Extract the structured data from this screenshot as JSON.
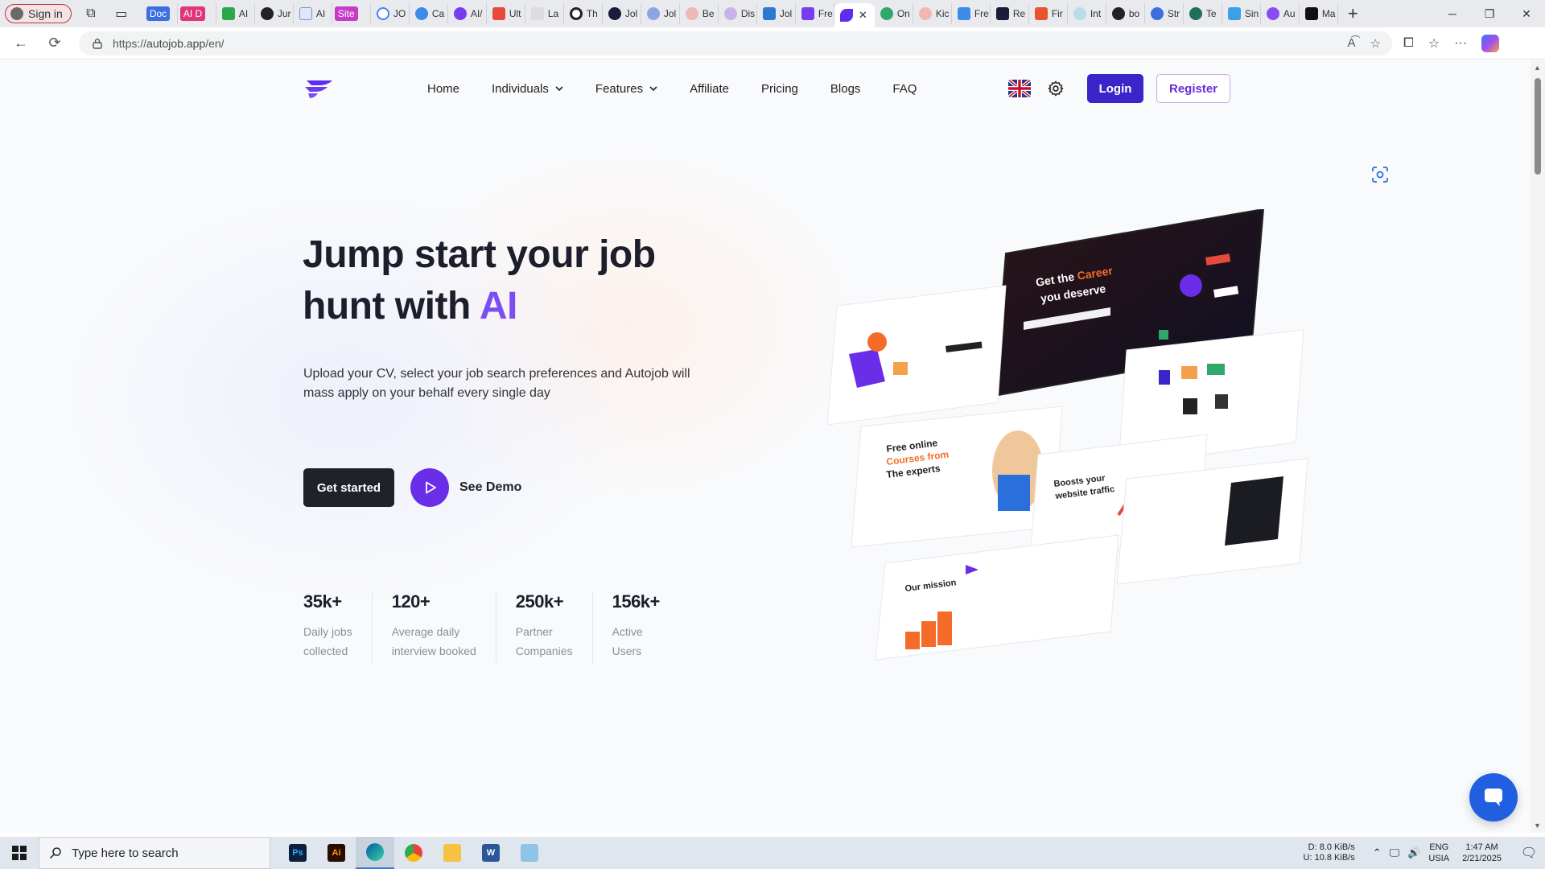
{
  "browser": {
    "profile_label": "Sign in",
    "tabs": [
      "Doc",
      "AI D",
      "AI",
      "Jur",
      "AI",
      "Site",
      "JO",
      "Ca",
      "AI/",
      "Ult",
      "La",
      "Th",
      "Jol",
      "Jol",
      "Be",
      "Dis",
      "Jol",
      "Fre",
      "",
      "On",
      "Kic",
      "Fre",
      "Re",
      "Fir",
      "Int",
      "bo",
      "Str",
      "Te",
      "Sin",
      "Au",
      "Ma"
    ],
    "url_prefix": "https://",
    "url_host": "autojob.app",
    "url_path": "/en/",
    "window_controls": {
      "minimize": "─",
      "restore": "❐",
      "close": "✕"
    }
  },
  "site": {
    "nav": {
      "items": [
        {
          "label": "Home"
        },
        {
          "label": "Individuals"
        },
        {
          "label": "Features"
        },
        {
          "label": "Affiliate"
        },
        {
          "label": "Pricing"
        },
        {
          "label": "Blogs"
        },
        {
          "label": "FAQ"
        }
      ],
      "login": "Login",
      "register": "Register"
    },
    "hero": {
      "title_line1": "Jump start your job",
      "title_line2_prefix": "hunt with ",
      "title_accent": "AI",
      "subtitle": "Upload your CV, select your job search preferences and Autojob will mass apply on your behalf every single day",
      "cta_primary": "Get started",
      "cta_secondary": "See Demo"
    },
    "stats": [
      {
        "value": "35k+",
        "label_line1": "Daily jobs",
        "label_line2": "collected"
      },
      {
        "value": "120+",
        "label_line1": "Average daily",
        "label_line2": "interview booked"
      },
      {
        "value": "250k+",
        "label_line1": "Partner",
        "label_line2": "Companies"
      },
      {
        "value": "156k+",
        "label_line1": "Active",
        "label_line2": "Users"
      }
    ],
    "mockup": {
      "career_title": "Get the",
      "career_accent": "Career",
      "career_title_end": "you deserve",
      "courses_line1": "Free online",
      "courses_line2": "Courses from",
      "courses_line3": "The experts",
      "traffic_line1": "Boosts your",
      "traffic_line2": "website traffic",
      "mission_title": "Our mission"
    },
    "colors": {
      "primary": "#3b24c9",
      "accent": "#7b4ef2",
      "dark_button": "#1f2228",
      "chat": "#1f5fe0"
    }
  },
  "taskbar": {
    "search_placeholder": "Type here to search",
    "apps": [
      "Ps",
      "Ai",
      "Edge",
      "Chrome",
      "Explorer",
      "W",
      "Notepad"
    ],
    "net_down": "D:      8.0 KiB/s",
    "net_up": "U:    10.8 KiB/s",
    "lang_line1": "ENG",
    "lang_line2": "USIA",
    "time": "1:47 AM",
    "date": "2/21/2025"
  }
}
